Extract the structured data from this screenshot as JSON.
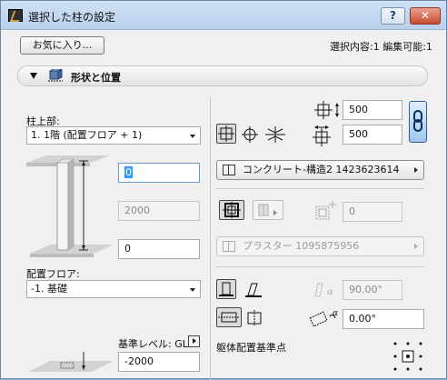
{
  "window": {
    "title": "選択した柱の設定",
    "help_label": "?",
    "close_label": "✕"
  },
  "toolbar": {
    "favorites_label": "お気に入り...",
    "selection_info": "選択内容:1 編集可能:1"
  },
  "section": {
    "title": "形状と位置"
  },
  "left": {
    "top_label": "柱上部:",
    "top_dropdown": "1. 1階 (配置フロア + 1)",
    "offset_top_value": "0",
    "height_value": "2000",
    "offset_bottom_value": "0",
    "home_floor_label": "配置フロア:",
    "home_floor_dropdown": "-1. 基礎",
    "ref_level_label": "基準レベル: GL",
    "ref_level_value": "-2000"
  },
  "right": {
    "width_x": "500",
    "width_y": "500",
    "material_core": "コンクリート-構造2 1423623614",
    "veneer_value": "0",
    "material_veneer": "プラスター 1095875956",
    "slant_angle": "90.00°",
    "rotation_angle": "0.00°",
    "anchor_label": "躯体配置基準点"
  },
  "colors": {
    "titlebar": "#b9d1ec",
    "close_button": "#c84a31",
    "selection": "#3399ff"
  }
}
